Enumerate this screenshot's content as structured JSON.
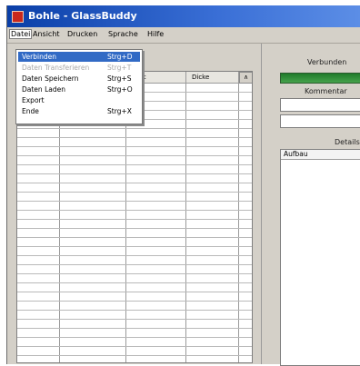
{
  "window": {
    "title": "Bohle - GlassBuddy",
    "icon": "app-icon"
  },
  "menubar": {
    "items": [
      "Datei",
      "Ansicht",
      "Drucken",
      "Sprache",
      "Hilfe"
    ]
  },
  "file_menu": {
    "items": [
      {
        "label": "Verbinden",
        "shortcut": "Strg+D",
        "state": "highlighted"
      },
      {
        "label": "Daten Transferieren",
        "shortcut": "Strg+T",
        "state": "disabled"
      },
      {
        "label": "Daten Speichern",
        "shortcut": "Strg+S",
        "state": "enabled"
      },
      {
        "label": "Daten Laden",
        "shortcut": "Strg+O",
        "state": "enabled"
      },
      {
        "label": "Export",
        "shortcut": "",
        "state": "enabled"
      },
      {
        "label": "Ende",
        "shortcut": "Strg+X",
        "state": "enabled"
      }
    ]
  },
  "grid": {
    "columns": [
      "",
      "",
      "rzeit",
      "Dicke"
    ],
    "scroll_glyph": "∧"
  },
  "right_panel": {
    "status_label": "Verbunden",
    "status_color": "#2f8a38",
    "comment_label": "Kommentar",
    "details_label": "Details",
    "details_header": "Aufbau"
  }
}
